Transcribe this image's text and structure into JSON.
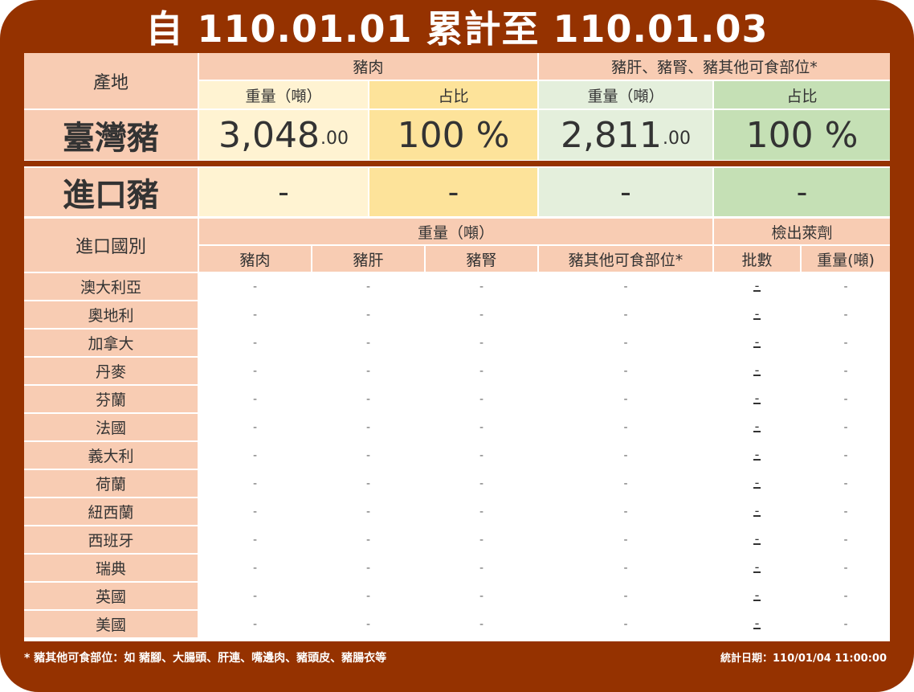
{
  "title": "自 110.01.01 累計至 110.01.03",
  "colors": {
    "frame": "#953200",
    "header_bg": "#f8ccb3",
    "pork_weight": "#fff3d2",
    "pork_ratio": "#fde39a",
    "offal_weight": "#e4efdc",
    "offal_ratio": "#c5e0b5"
  },
  "summary": {
    "origin_header": "產地",
    "pork_header": "豬肉",
    "offal_header": "豬肝、豬腎、豬其他可食部位*",
    "weight_label": "重量（噸）",
    "ratio_label": "占比",
    "taiwan": {
      "label": "臺灣豬",
      "pork_weight_int": "3,048",
      "pork_weight_dec": ".00",
      "pork_ratio": "100 %",
      "offal_weight_int": "2,811",
      "offal_weight_dec": ".00",
      "offal_ratio": "100 %"
    },
    "imported": {
      "label": "進口豬",
      "pork_weight": "-",
      "pork_ratio": "-",
      "offal_weight": "-",
      "offal_ratio": "-"
    }
  },
  "detail": {
    "country_header": "進口國別",
    "weight_header": "重量（噸）",
    "detect_header": "檢出萊劑",
    "columns": [
      "豬肉",
      "豬肝",
      "豬腎",
      "豬其他可食部位*",
      "批數",
      "重量(噸)"
    ],
    "rows": [
      {
        "country": "澳大利亞",
        "values": [
          "-",
          "-",
          "-",
          "-",
          "-",
          "-"
        ]
      },
      {
        "country": "奧地利",
        "values": [
          "-",
          "-",
          "-",
          "-",
          "-",
          "-"
        ]
      },
      {
        "country": "加拿大",
        "values": [
          "-",
          "-",
          "-",
          "-",
          "-",
          "-"
        ]
      },
      {
        "country": "丹麥",
        "values": [
          "-",
          "-",
          "-",
          "-",
          "-",
          "-"
        ]
      },
      {
        "country": "芬蘭",
        "values": [
          "-",
          "-",
          "-",
          "-",
          "-",
          "-"
        ]
      },
      {
        "country": "法國",
        "values": [
          "-",
          "-",
          "-",
          "-",
          "-",
          "-"
        ]
      },
      {
        "country": "義大利",
        "values": [
          "-",
          "-",
          "-",
          "-",
          "-",
          "-"
        ]
      },
      {
        "country": "荷蘭",
        "values": [
          "-",
          "-",
          "-",
          "-",
          "-",
          "-"
        ]
      },
      {
        "country": "紐西蘭",
        "values": [
          "-",
          "-",
          "-",
          "-",
          "-",
          "-"
        ]
      },
      {
        "country": "西班牙",
        "values": [
          "-",
          "-",
          "-",
          "-",
          "-",
          "-"
        ]
      },
      {
        "country": "瑞典",
        "values": [
          "-",
          "-",
          "-",
          "-",
          "-",
          "-"
        ]
      },
      {
        "country": "英國",
        "values": [
          "-",
          "-",
          "-",
          "-",
          "-",
          "-"
        ]
      },
      {
        "country": "美國",
        "values": [
          "-",
          "-",
          "-",
          "-",
          "-",
          "-"
        ]
      }
    ]
  },
  "footer": {
    "note": "* 豬其他可食部位：如 豬腳、大腸頭、肝連、嘴邊肉、豬頭皮、豬腸衣等",
    "date": "統計日期：110/01/04 11:00:00"
  }
}
